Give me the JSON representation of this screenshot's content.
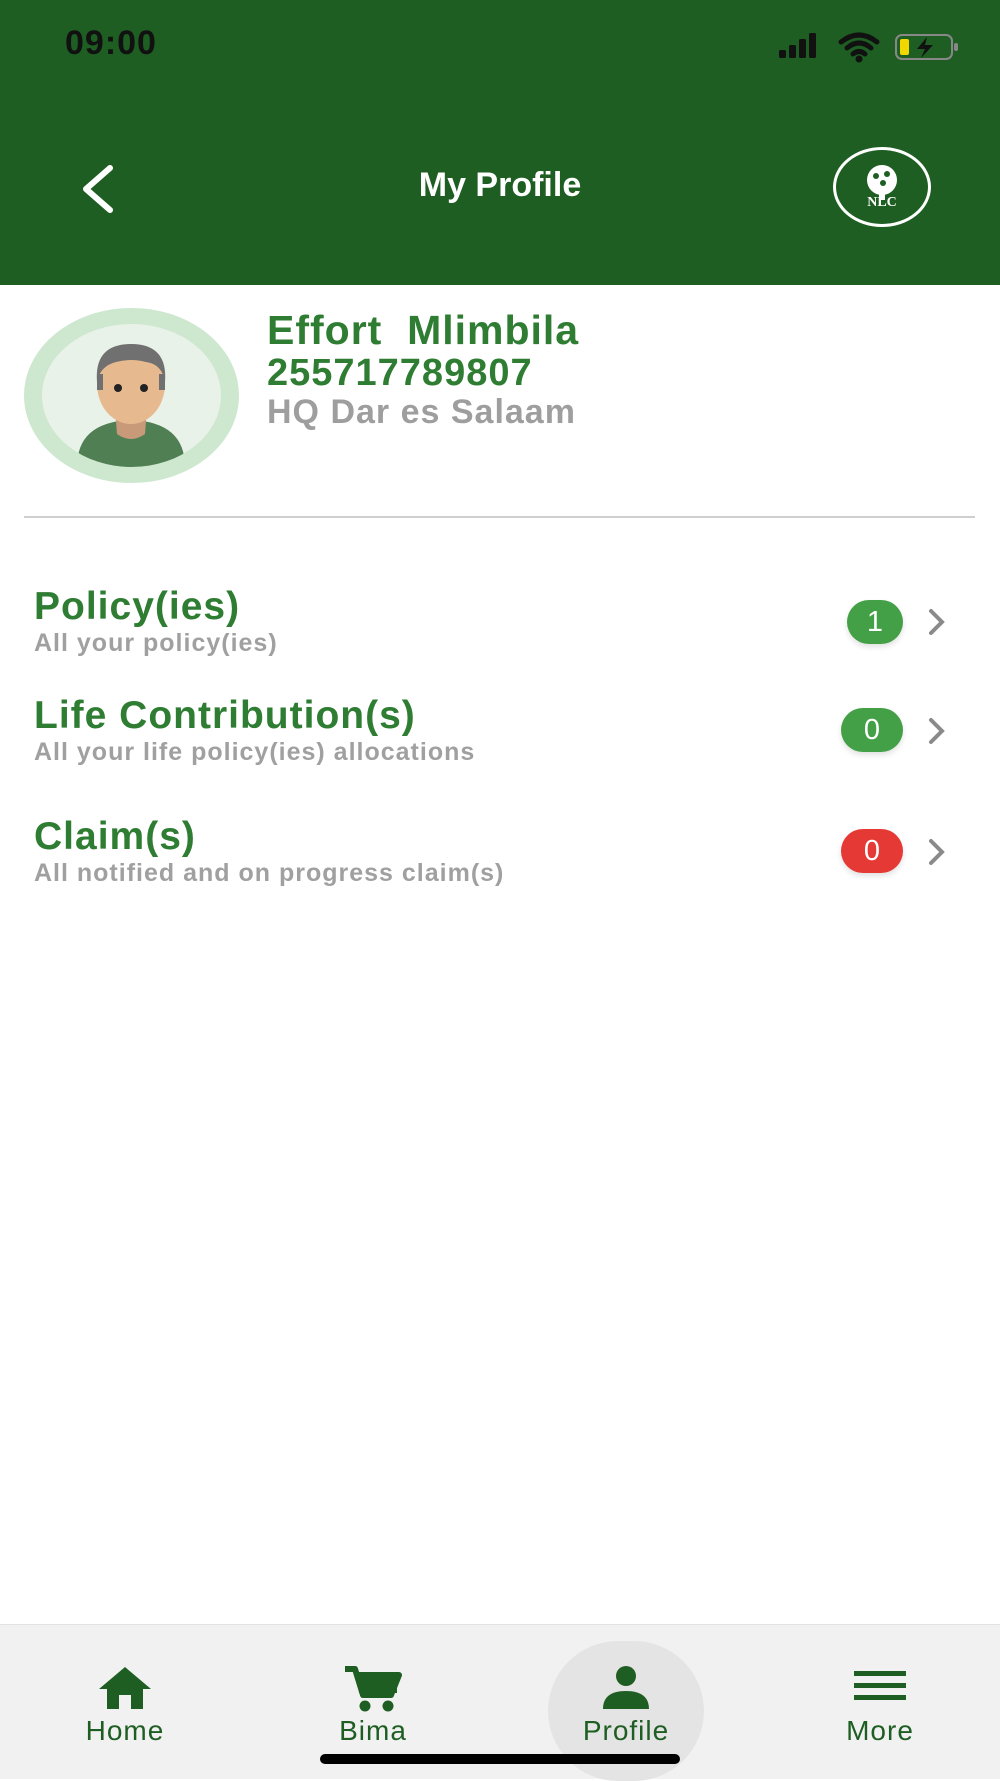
{
  "status_bar": {
    "time": "09:00"
  },
  "header": {
    "title": "My Profile",
    "logo_text": "NLC"
  },
  "profile": {
    "name": "Effort  Mlimbila",
    "phone": "255717789807",
    "location": "HQ Dar es Salaam"
  },
  "menu": [
    {
      "title": "Policy(ies)",
      "subtitle": "All your policy(ies)",
      "count": "1",
      "badge_color": "#43a047"
    },
    {
      "title": "Life Contribution(s)",
      "subtitle": "All your life policy(ies) allocations",
      "count": "0",
      "badge_color": "#43a047"
    },
    {
      "title": "Claim(s)",
      "subtitle": "All notified and on progress claim(s)",
      "count": "0",
      "badge_color": "#e53935"
    }
  ],
  "bottom_nav": [
    {
      "label": "Home",
      "icon": "home-icon",
      "active": false
    },
    {
      "label": "Bima",
      "icon": "cart-icon",
      "active": false
    },
    {
      "label": "Profile",
      "icon": "person-icon",
      "active": true
    },
    {
      "label": "More",
      "icon": "menu-icon",
      "active": false
    }
  ],
  "colors": {
    "header_bg": "#1e5e22",
    "brand_green": "#2e7d32",
    "subtitle_gray": "#a0a0a0",
    "badge_green": "#43a047",
    "badge_red": "#e53935"
  }
}
